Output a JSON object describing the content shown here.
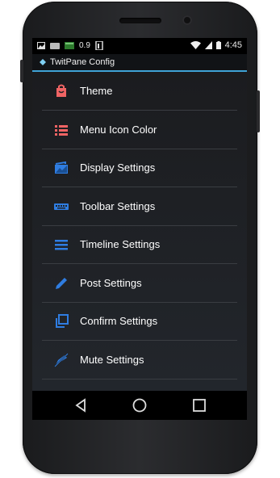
{
  "status_bar": {
    "icons_left": [
      "image-icon",
      "keyboard-icon",
      "battery-icon",
      "sim-icon"
    ],
    "speed": "0.9",
    "time": "4:45"
  },
  "app_bar": {
    "title": "TwitPane Config"
  },
  "menu": {
    "items": [
      {
        "label": "Theme",
        "icon": "bag-icon",
        "color": "#f06464"
      },
      {
        "label": "Menu Icon Color",
        "icon": "list-icon",
        "color": "#f06464"
      },
      {
        "label": "Display Settings",
        "icon": "image-stack-icon",
        "color": "#2f7de1"
      },
      {
        "label": "Toolbar Settings",
        "icon": "keyboard-icon",
        "color": "#2f7de1"
      },
      {
        "label": "Timeline Settings",
        "icon": "menu-lines-icon",
        "color": "#2f7de1"
      },
      {
        "label": "Post Settings",
        "icon": "pencil-icon",
        "color": "#2f7de1"
      },
      {
        "label": "Confirm Settings",
        "icon": "copy-icon",
        "color": "#2f7de1"
      },
      {
        "label": "Mute Settings",
        "icon": "mute-icon",
        "color": "#2f7de1"
      }
    ]
  },
  "nav_bar": {
    "buttons": [
      "back-icon",
      "home-icon",
      "recents-icon"
    ]
  }
}
